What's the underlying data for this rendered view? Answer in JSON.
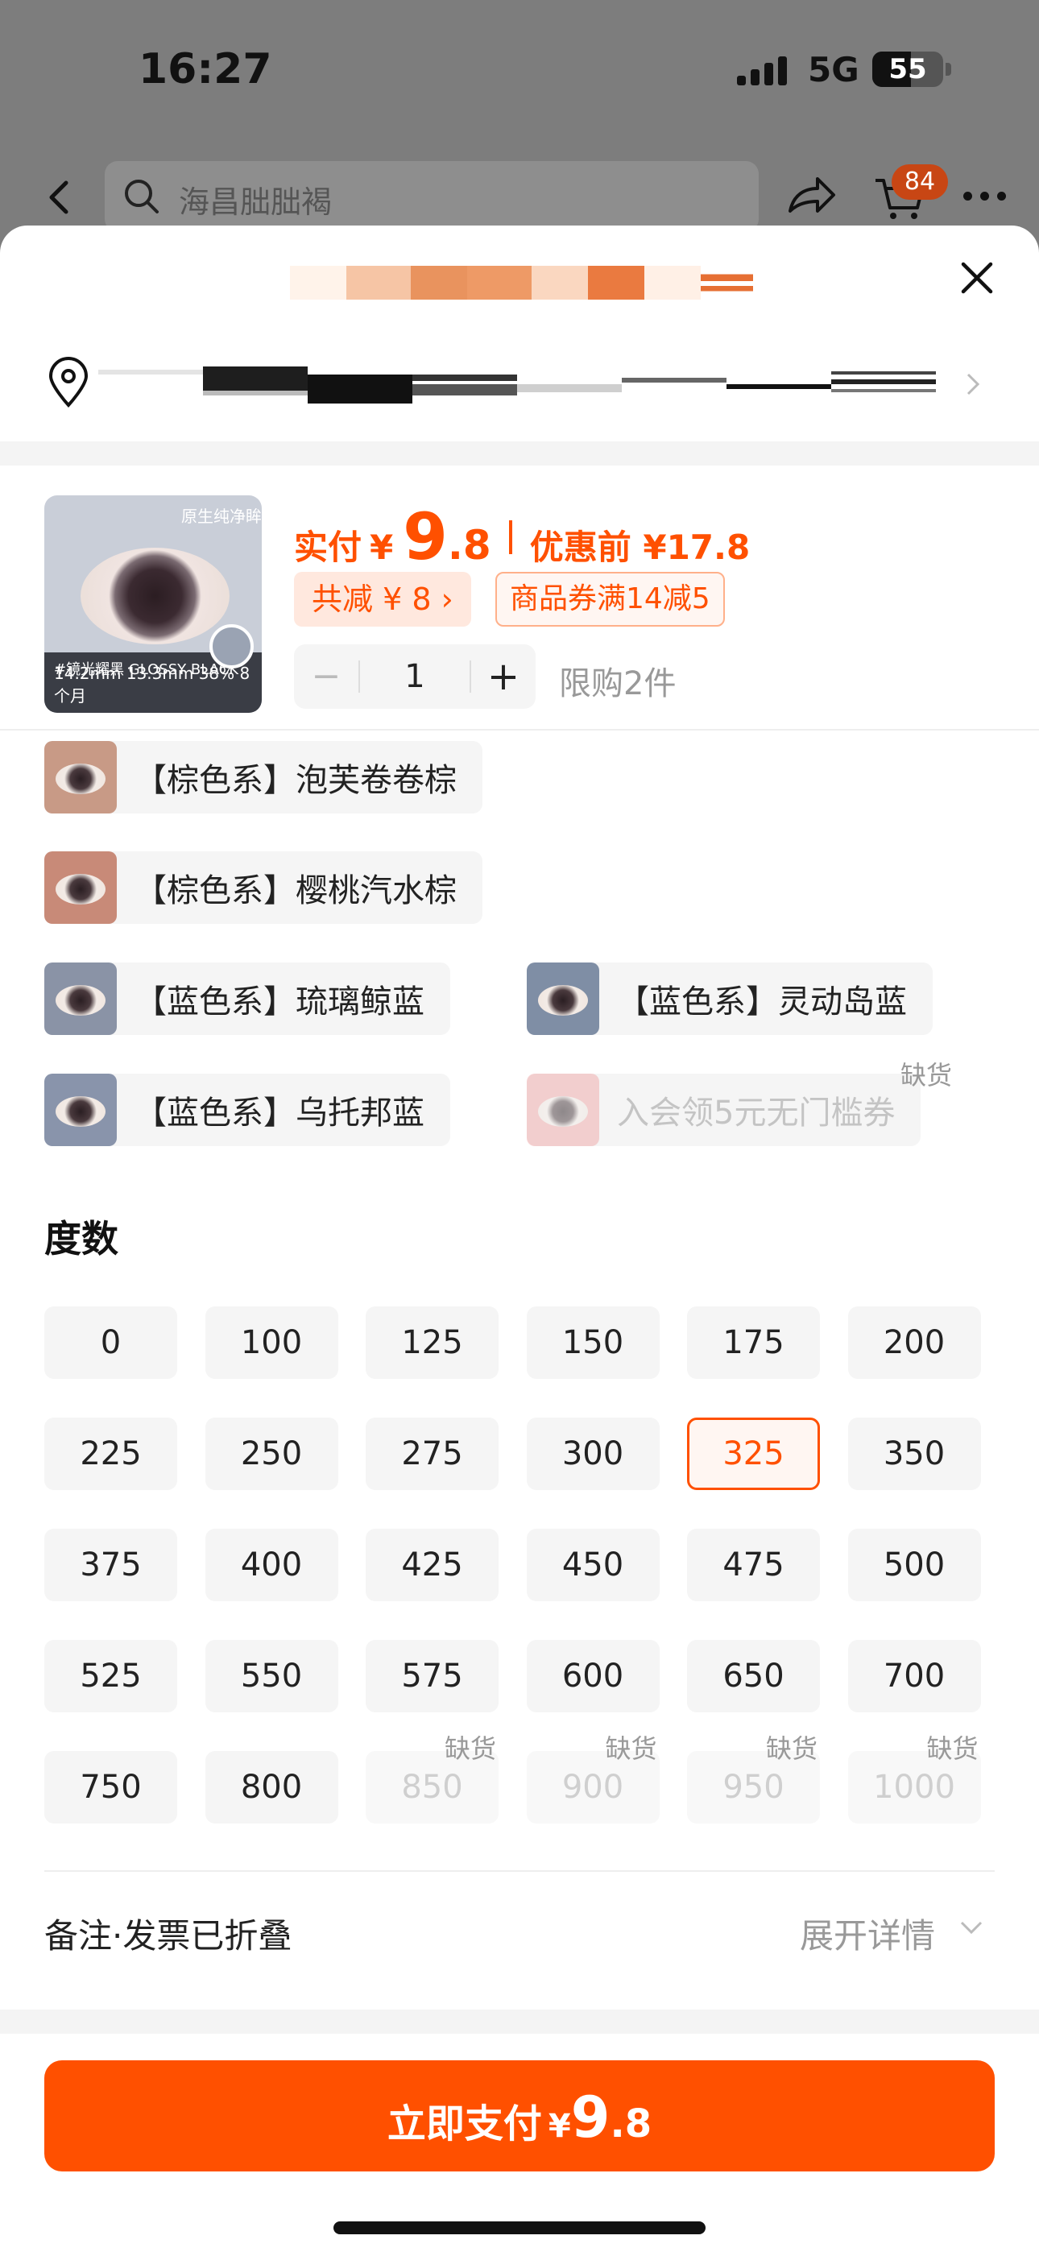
{
  "status_bar": {
    "time": "16:27",
    "network": "5G",
    "battery": "55",
    "battery_level": 0.55
  },
  "header": {
    "search_placeholder": "海昌朏朏褐",
    "cart_count": "84"
  },
  "sheet": {
    "product": {
      "image_tag": "原生纯净眸",
      "image_caption": "#镜光耀黑 GLOSSY BLACK",
      "image_specs": "14.2mm 13.3mm 38% 8个月",
      "price_label": "实付",
      "price_yen": "¥",
      "price_int": "9",
      "price_dec": ".8",
      "pre_price": "优惠前 ¥17.8",
      "saved_badge": "共减 ¥ 8 ›",
      "coupon_badge": "商品券满14减5",
      "qty_minus": "−",
      "qty": "1",
      "qty_plus": "+",
      "limit": "限购2件"
    },
    "variants": [
      {
        "label": "【棕色系】泡芙卷卷棕",
        "color": "#c89a86"
      },
      {
        "label": "【棕色系】樱桃汽水棕",
        "color": "#c88a78"
      },
      {
        "label": "【蓝色系】琉璃鲸蓝",
        "color": "#8a93a6"
      },
      {
        "label": "【蓝色系】灵动岛蓝",
        "color": "#7f8ea5"
      },
      {
        "label": "【蓝色系】乌托邦蓝",
        "color": "#8994ab"
      },
      {
        "label": "入会领5元无门槛券",
        "color": "#f0a9a9",
        "status": "缺货"
      }
    ],
    "degree_title": "度数",
    "degrees": [
      {
        "v": "0"
      },
      {
        "v": "100"
      },
      {
        "v": "125"
      },
      {
        "v": "150"
      },
      {
        "v": "175"
      },
      {
        "v": "200"
      },
      {
        "v": "225"
      },
      {
        "v": "250"
      },
      {
        "v": "275"
      },
      {
        "v": "300"
      },
      {
        "v": "325",
        "selected": true
      },
      {
        "v": "350"
      },
      {
        "v": "375"
      },
      {
        "v": "400"
      },
      {
        "v": "425"
      },
      {
        "v": "450"
      },
      {
        "v": "475"
      },
      {
        "v": "500"
      },
      {
        "v": "525"
      },
      {
        "v": "550"
      },
      {
        "v": "575"
      },
      {
        "v": "600"
      },
      {
        "v": "650"
      },
      {
        "v": "700"
      },
      {
        "v": "750"
      },
      {
        "v": "800"
      },
      {
        "v": "850",
        "status": "缺货"
      },
      {
        "v": "900",
        "status": "缺货"
      },
      {
        "v": "950",
        "status": "缺货"
      },
      {
        "v": "1000",
        "status": "缺货"
      }
    ],
    "note": "备注·发票已折叠",
    "expand": "展开详情",
    "pay": {
      "label": "立即支付",
      "yen": "¥",
      "int": "9",
      "dec": ".8"
    }
  },
  "colors": {
    "accent": "#ff5000",
    "accent_light": "#ffe8de"
  }
}
